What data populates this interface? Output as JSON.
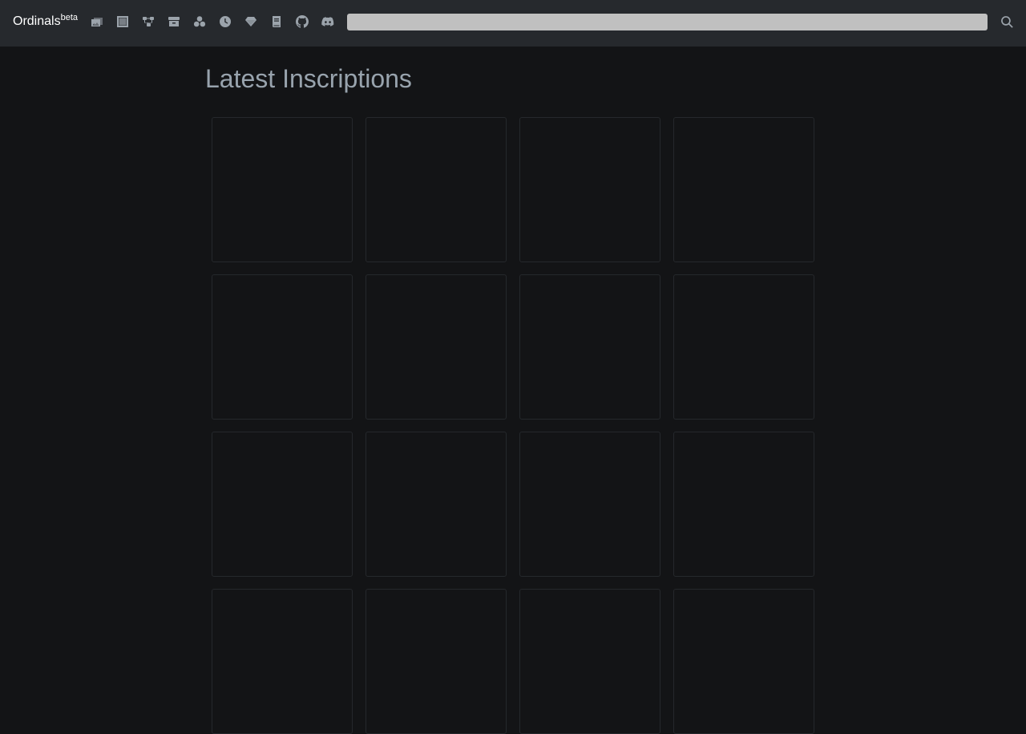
{
  "header": {
    "brand": "Ordinals",
    "brand_sup": "beta",
    "icons": [
      "images-icon",
      "square-icon",
      "sitemap-icon",
      "archive-box-icon",
      "cubes-icon",
      "clock-icon",
      "gem-icon",
      "book-icon",
      "github-icon",
      "discord-icon"
    ],
    "search": {
      "value": "",
      "placeholder": ""
    },
    "search_icon": "magnifying-glass-icon"
  },
  "main": {
    "title": "Latest Inscriptions",
    "inscription_count_visible": 16,
    "columns": 4
  },
  "colors": {
    "background": "#131416",
    "navbar": "#26292d",
    "text_muted": "#98a3ad",
    "card_border": "#25282c",
    "search_bg": "#c0c0c0"
  }
}
